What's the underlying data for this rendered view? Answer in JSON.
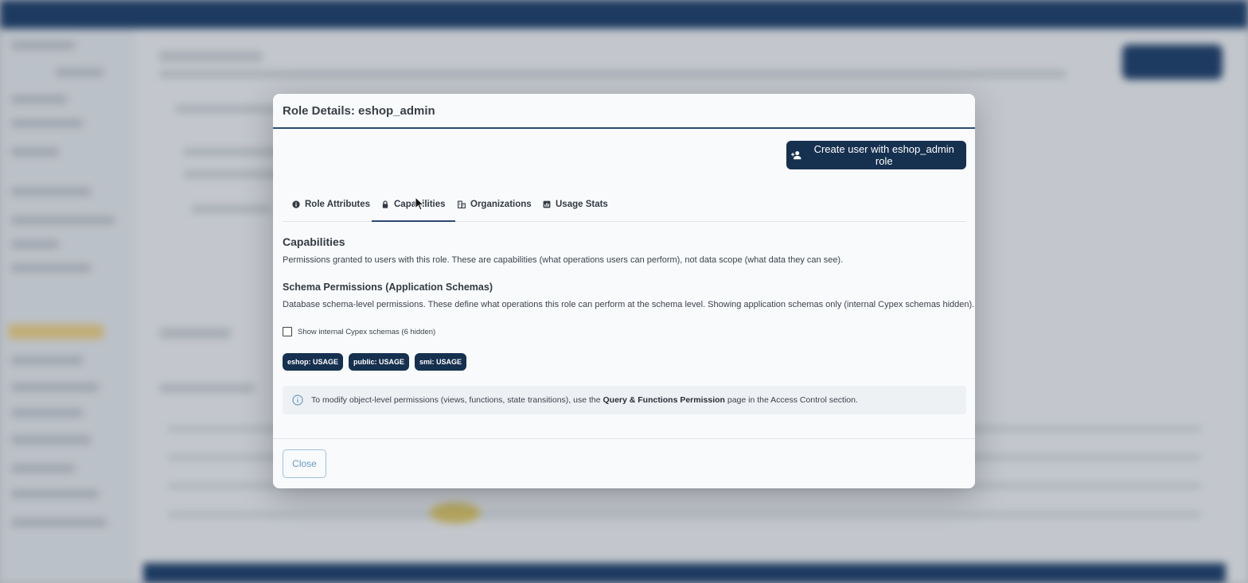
{
  "modal": {
    "title": "Role Details: eshop_admin",
    "create_button_label": "Create user with eshop_admin role",
    "tabs": [
      {
        "label": "Role Attributes",
        "icon": "info-circle-icon",
        "active": false
      },
      {
        "label": "Capabilities",
        "icon": "lock-icon",
        "active": true
      },
      {
        "label": "Organizations",
        "icon": "building-icon",
        "active": false
      },
      {
        "label": "Usage Stats",
        "icon": "chart-icon",
        "active": false
      }
    ],
    "capabilities": {
      "heading": "Capabilities",
      "description": "Permissions granted to users with this role. These are capabilities (what operations users can perform), not data scope (what data they can see)."
    },
    "schema_permissions": {
      "heading": "Schema Permissions (Application Schemas)",
      "description": "Database schema-level permissions. These define what operations this role can perform at the schema level. Showing application schemas only (internal Cypex schemas hidden).",
      "toggle_label": "Show internal Cypex schemas (6 hidden)",
      "chips": [
        "eshop: USAGE",
        "public: USAGE",
        "smi: USAGE"
      ]
    },
    "info": {
      "text_before": "To modify object-level permissions (views, functions, state transitions), use the",
      "link_text": "Query & Functions Permission",
      "text_after": "page in the Access Control section."
    },
    "close_label": "Close"
  },
  "colors": {
    "primary": "#16304f",
    "accent_border": "#2b4a72",
    "close_text": "#6b9ac0"
  }
}
